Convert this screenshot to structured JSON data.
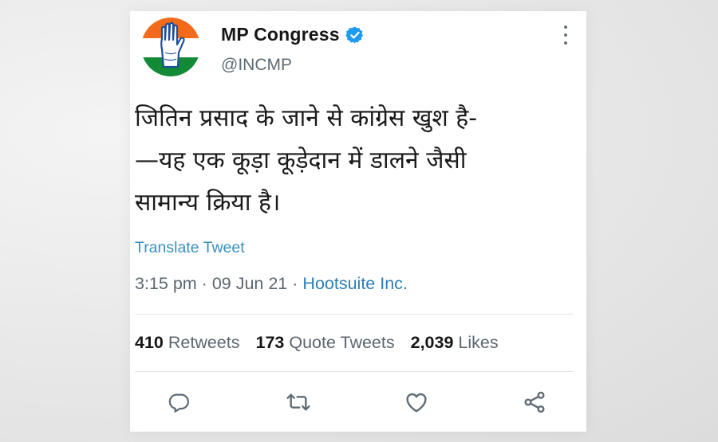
{
  "account": {
    "name": "MP Congress",
    "handle": "@INCMP",
    "verified": true,
    "logo_colors": {
      "saffron": "#f26b1d",
      "green": "#138a36",
      "blue": "#1d4f9c"
    }
  },
  "tweet": {
    "lines": [
      "जितिन प्रसाद के जाने से कांग्रेस खुश है-",
      "—यह एक कूड़ा कूड़ेदान में डालने जैसी",
      "सामान्य क्रिया है।"
    ],
    "translate_label": "Translate Tweet",
    "time": "3:15 pm",
    "date": "09 Jun 21",
    "source": "Hootsuite Inc.",
    "separator": "·"
  },
  "stats": {
    "retweets_count": "410",
    "retweets_label": "Retweets",
    "quotes_count": "173",
    "quotes_label": "Quote Tweets",
    "likes_count": "2,039",
    "likes_label": "Likes"
  },
  "actions": [
    "reply-icon",
    "retweet-icon",
    "like-icon",
    "share-icon"
  ],
  "colors": {
    "link": "#2d7fb8",
    "verified": "#1d9bf0",
    "icon": "#5f6b75"
  }
}
